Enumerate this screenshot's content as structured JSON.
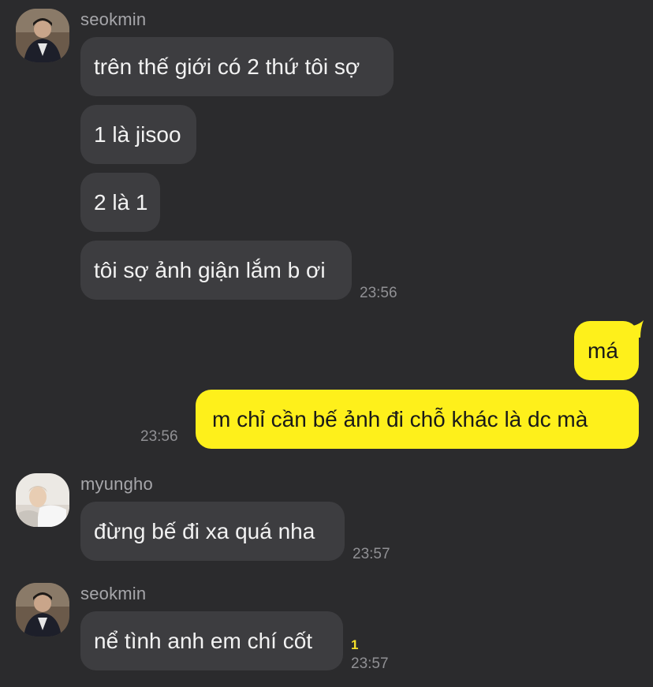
{
  "groups": [
    {
      "sender": "seokmin",
      "avatar_icon": "user-photo-icon",
      "messages": [
        "trên thế giới có 2 thứ tôi sợ",
        "1 là jisoo",
        "2 là 1",
        "tôi sợ ảnh giận lắm b ơi"
      ],
      "time": "23:56"
    },
    {
      "sender": "me",
      "messages": [
        "má",
        "m chỉ cần bế ảnh đi chỗ khác là dc mà"
      ],
      "time": "23:56"
    },
    {
      "sender": "myungho",
      "avatar_icon": "user-photo-icon",
      "messages": [
        "đừng bế đi xa quá nha"
      ],
      "time": "23:57"
    },
    {
      "sender": "seokmin",
      "avatar_icon": "user-photo-icon",
      "messages": [
        "nể tình anh em chí cốt"
      ],
      "time": "23:57",
      "unread_count": "1"
    }
  ],
  "colors": {
    "background": "#2b2b2d",
    "incoming_bubble": "#3d3d40",
    "outgoing_bubble": "#fef01b",
    "unread": "#f5e02a"
  }
}
